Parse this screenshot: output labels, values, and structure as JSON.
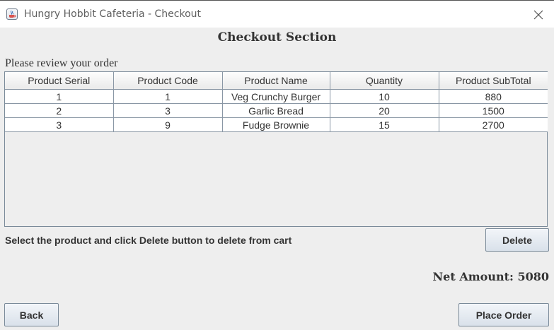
{
  "window": {
    "title": "Hungry Hobbit Cafeteria - Checkout",
    "icon": "java-app-icon",
    "close_icon": "close-icon"
  },
  "heading": "Checkout Section",
  "review_label": "Please review your order",
  "table": {
    "headers": [
      "Product Serial",
      "Product Code",
      "Product Name",
      "Quantity",
      "Product SubTotal"
    ],
    "rows": [
      [
        "1",
        "1",
        "Veg Crunchy Burger",
        "10",
        "880"
      ],
      [
        "2",
        "3",
        "Garlic Bread",
        "20",
        "1500"
      ],
      [
        "3",
        "9",
        "Fudge Brownie",
        "15",
        "2700"
      ]
    ]
  },
  "hint": "Select the product and click Delete button to delete from cart",
  "buttons": {
    "delete": "Delete",
    "back": "Back",
    "place_order": "Place Order"
  },
  "net_amount": "Net Amount: 5080"
}
